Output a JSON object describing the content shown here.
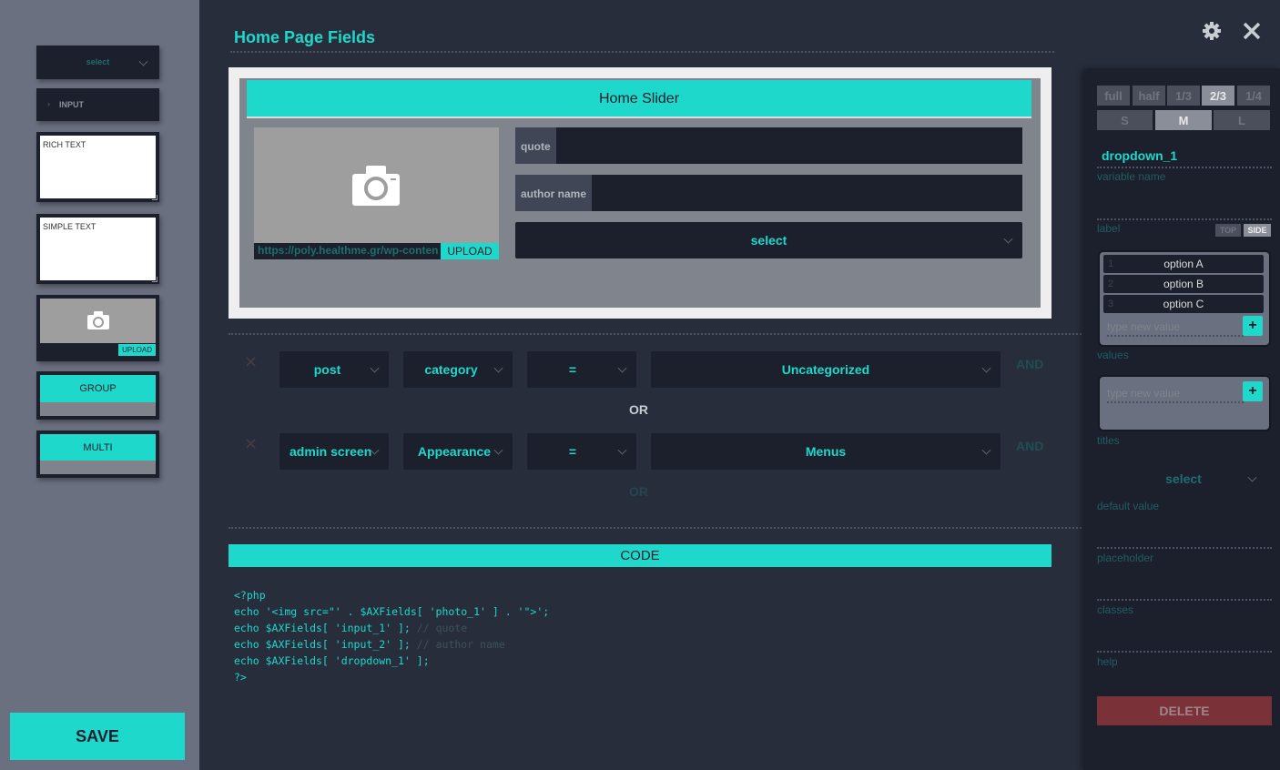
{
  "sidebar": {
    "select_label": "select",
    "input_label": "INPUT",
    "rich_text": "RICH TEXT",
    "simple_text": "SIMPLE TEXT",
    "upload_label": "UPLOAD",
    "group_label": "GROUP",
    "multi_label": "MULTI",
    "save_label": "SAVE"
  },
  "header": {
    "title": "Home Page Fields"
  },
  "preview": {
    "group_title": "Home Slider",
    "image_url": "https://poly.healthme.gr/wp-conten",
    "upload_label": "UPLOAD",
    "quote_label": "quote",
    "author_label": "author name",
    "select_label": "select"
  },
  "conditions": {
    "rows": [
      {
        "type": "post",
        "param": "category",
        "op": "=",
        "value": "Uncategorized",
        "and": "AND"
      },
      {
        "type": "admin screen",
        "param": "Appearance",
        "op": "=",
        "value": "Menus",
        "and": "AND"
      }
    ],
    "or_label": "OR",
    "or_add_label": "OR"
  },
  "code": {
    "title": "CODE",
    "lines": [
      "<?php",
      "echo '<img src=\"' . $AXFields[ 'photo_1' ] . '\">';",
      "echo $AXFields[ 'input_1' ]; ",
      "echo $AXFields[ 'input_2' ]; ",
      "echo $AXFields[ 'dropdown_1' ];",
      "?>"
    ],
    "comments": [
      "// quote",
      "// author name"
    ]
  },
  "settings": {
    "widths": [
      "full",
      "half",
      "1/3",
      "2/3",
      "1/4"
    ],
    "active_width": "2/3",
    "sizes": [
      "S",
      "M",
      "L"
    ],
    "active_size": "M",
    "variable_name_value": "dropdown_1",
    "variable_name_label": "variable name",
    "label_label": "label",
    "label_pos": [
      "TOP",
      "SIDE"
    ],
    "values": [
      {
        "n": "1",
        "v": "option A"
      },
      {
        "n": "2",
        "v": "option B"
      },
      {
        "n": "3",
        "v": "option C"
      }
    ],
    "new_value_placeholder": "type new value",
    "values_label": "values",
    "titles_label": "titles",
    "default_select": "select",
    "default_value_label": "default value",
    "placeholder_label": "placeholder",
    "classes_label": "classes",
    "help_label": "help",
    "delete_label": "DELETE"
  },
  "colors": {
    "accent": "#1ed8cc",
    "delete": "#7a3238"
  }
}
